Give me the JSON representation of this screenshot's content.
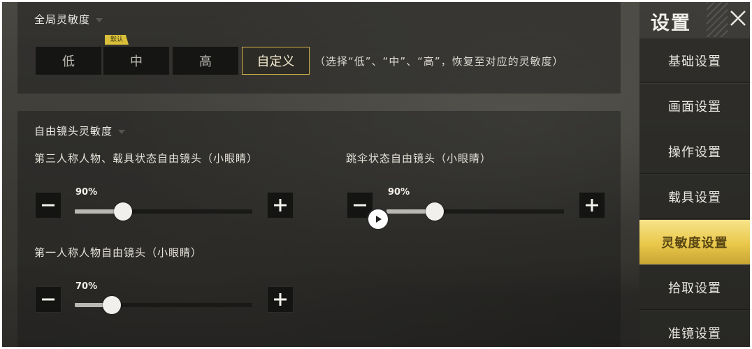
{
  "global_sensitivity": {
    "title": "全局灵敏度",
    "presets": [
      "低",
      "中",
      "高",
      "自定义"
    ],
    "selected": "自定义",
    "default_badge": "默认",
    "hint": "（选择“低”、“中”、“高”，恢复至对应的灵敏度）"
  },
  "free_camera": {
    "title": "自由镜头灵敏度",
    "sliders": [
      {
        "label": "第三人称人物、载具状态自由镜头（小眼睛）",
        "value_text": "90%",
        "value": 0.9
      },
      {
        "label": "跳伞状态自由镜头（小眼睛）",
        "value_text": "90%",
        "value": 0.9
      },
      {
        "label": "第一人称人物自由镜头（小眼睛）",
        "value_text": "70%",
        "value": 0.7
      }
    ]
  },
  "sidebar": {
    "title": "设置",
    "items": [
      {
        "label": "基础设置",
        "active": false
      },
      {
        "label": "画面设置",
        "active": false
      },
      {
        "label": "操作设置",
        "active": false
      },
      {
        "label": "载具设置",
        "active": false
      },
      {
        "label": "灵敏度设置",
        "active": true
      },
      {
        "label": "拾取设置",
        "active": false
      },
      {
        "label": "准镜设置",
        "active": false
      }
    ]
  },
  "colors": {
    "accent": "#e9c84b",
    "selected_border": "#d5b548"
  },
  "icons": {
    "close": "close-icon",
    "minus": "minus-icon",
    "plus": "plus-icon",
    "play": "play-icon"
  }
}
